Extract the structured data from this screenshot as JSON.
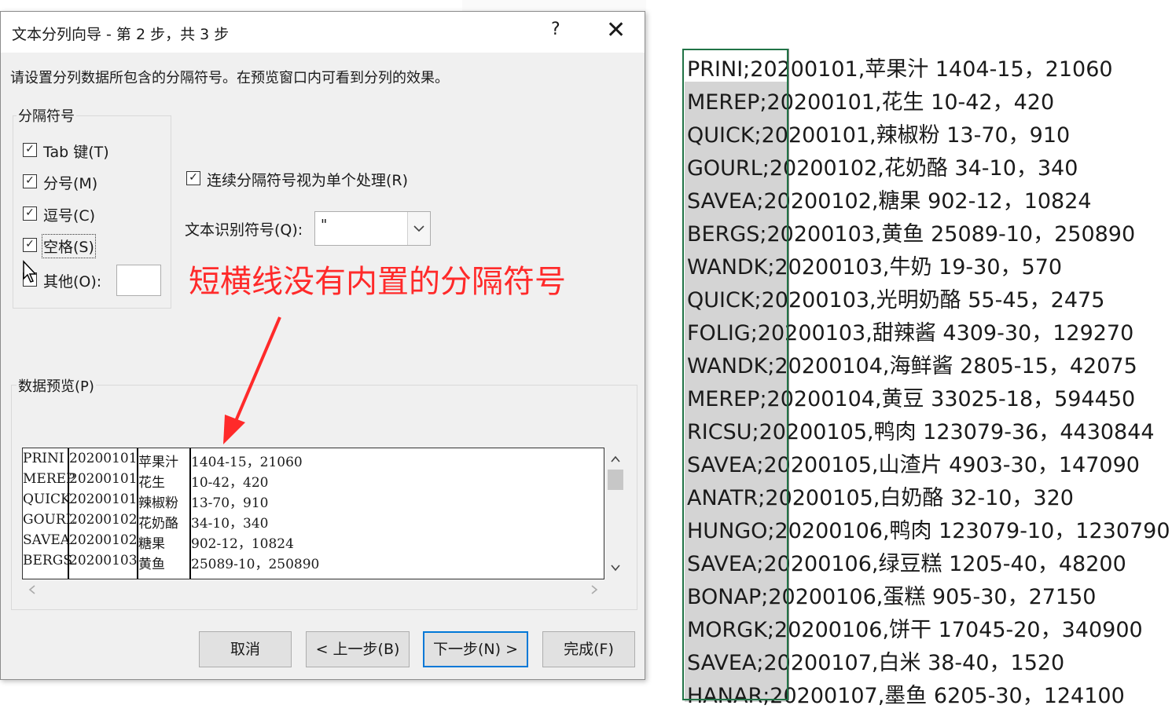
{
  "dialog": {
    "title": "文本分列向导 - 第 2 步，共 3 步",
    "help": "?",
    "close": "✕",
    "instruction": "请设置分列数据所包含的分隔符号。在预览窗口内可看到分列的效果。",
    "delimiters_group": "分隔符号",
    "delimiters": [
      {
        "label": "Tab 键(T)",
        "checked": true
      },
      {
        "label": "分号(M)",
        "checked": true
      },
      {
        "label": "逗号(C)",
        "checked": true
      },
      {
        "label": "空格(S)",
        "checked": true
      },
      {
        "label": "其他(O):",
        "checked": false
      }
    ],
    "consecutive_label": "连续分隔符号视为单个处理(R)",
    "consecutive_checked": true,
    "qualifier_label": "文本识别符号(Q):",
    "qualifier_value": "\"",
    "preview_label": "数据预览(P)",
    "preview_rows": [
      [
        "PRINI",
        "20200101",
        "苹果汁",
        "1404-15，21060"
      ],
      [
        "MEREP",
        "20200101",
        "花生",
        "10-42，420"
      ],
      [
        "QUICK",
        "20200101",
        "辣椒粉",
        "13-70，910"
      ],
      [
        "GOURL",
        "20200102",
        "花奶酪",
        "34-10，340"
      ],
      [
        "SAVEA",
        "20200102",
        "糖果",
        "902-12，10824"
      ],
      [
        "BERGS",
        "20200103",
        "黄鱼",
        "25089-10，250890"
      ]
    ],
    "buttons": {
      "cancel": "取消",
      "back": "< 上一步(B)",
      "next": "下一步(N) >",
      "finish": "完成(F)"
    }
  },
  "annotation": {
    "text": "短横线没有内置的分隔符号",
    "color": "#ff2a2a"
  },
  "sheet_rows": [
    "PRINI;20200101,苹果汁 1404-15，21060",
    "MEREP;20200101,花生 10-42，420",
    "QUICK;20200101,辣椒粉 13-70，910",
    "GOURL;20200102,花奶酪 34-10，340",
    "SAVEA;20200102,糖果 902-12，10824",
    "BERGS;20200103,黄鱼 25089-10，250890",
    "WANDK;20200103,牛奶 19-30，570",
    "QUICK;20200103,光明奶酪 55-45，2475",
    "FOLIG;20200103,甜辣酱 4309-30，129270",
    "WANDK;20200104,海鲜酱 2805-15，42075",
    "MEREP;20200104,黄豆 33025-18，594450",
    "RICSU;20200105,鸭肉 123079-36，4430844",
    "SAVEA;20200105,山渣片 4903-30，147090",
    "ANATR;20200105,白奶酪 32-10，320",
    "HUNGO;20200106,鸭肉 123079-10，1230790",
    "SAVEA;20200106,绿豆糕 1205-40，48200",
    "BONAP;20200106,蛋糕 905-30，27150",
    "MORGK;20200106,饼干 17045-20，340900",
    "SAVEA;20200107,白米 38-40，1520",
    "HANAR;20200107,墨鱼 6205-30，124100"
  ],
  "colors": {
    "selection_border": "#217346",
    "default_button_border": "#0078d7"
  }
}
